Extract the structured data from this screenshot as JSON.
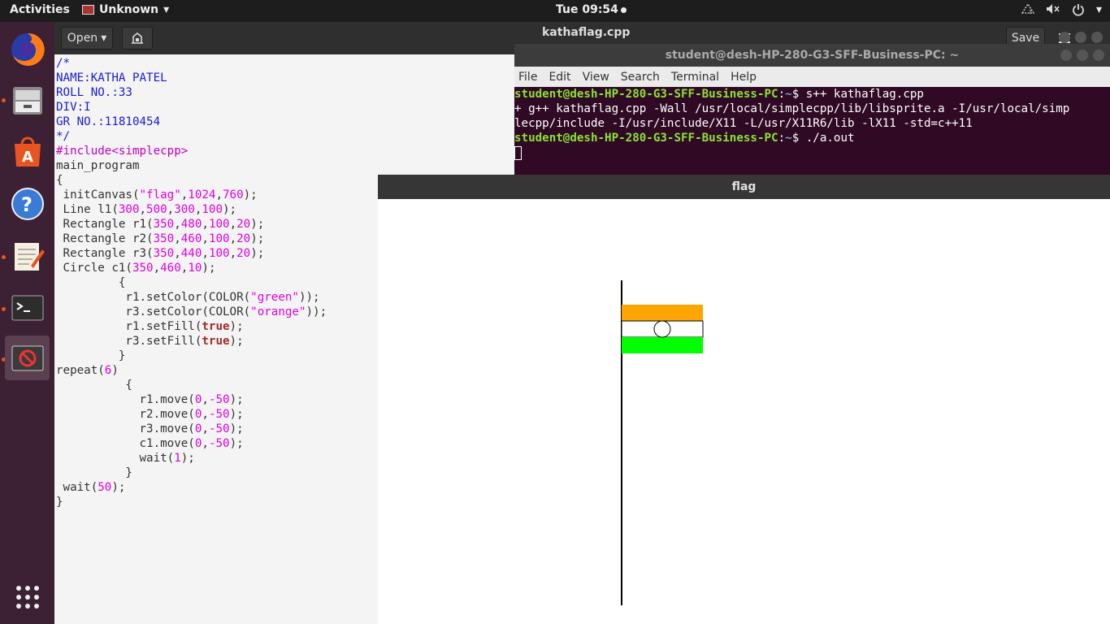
{
  "topbar": {
    "activities": "Activities",
    "app_name": "Unknown",
    "clock": "Tue 09:54"
  },
  "dock": {
    "items": [
      {
        "name": "firefox-icon"
      },
      {
        "name": "files-icon"
      },
      {
        "name": "software-center-icon"
      },
      {
        "name": "help-icon"
      },
      {
        "name": "text-editor-icon"
      },
      {
        "name": "terminal-icon"
      },
      {
        "name": "running-app-icon"
      },
      {
        "name": "show-apps-icon"
      }
    ]
  },
  "editor": {
    "open_label": "Open",
    "title": "kathaflag.cpp",
    "save_label": "Save",
    "code_lines": [
      "/*",
      "NAME:KATHA PATEL",
      "ROLL NO.:33",
      "DIV:I",
      "GR NO.:11810454",
      "*/",
      "#include<simplecpp>",
      "main_program",
      "{",
      " initCanvas(\"flag\",1024,760);",
      " Line l1(300,500,300,100);",
      " Rectangle r1(350,480,100,20);",
      " Rectangle r2(350,460,100,20);",
      " Rectangle r3(350,440,100,20);",
      " Circle c1(350,460,10);",
      "         {",
      "          r1.setColor(COLOR(\"green\"));",
      "          r3.setColor(COLOR(\"orange\"));",
      "          r1.setFill(true);",
      "          r3.setFill(true);",
      "         }",
      "repeat(6)",
      "          {",
      "            r1.move(0,-50);",
      "            r2.move(0,-50);",
      "            r3.move(0,-50);",
      "            c1.move(0,-50);",
      "            wait(1);",
      "          }",
      " wait(50);",
      "}"
    ]
  },
  "terminal": {
    "title": "student@desh-HP-280-G3-SFF-Business-PC: ~",
    "menu": [
      "File",
      "Edit",
      "View",
      "Search",
      "Terminal",
      "Help"
    ],
    "prompt_user": "student@desh-HP-280-G3-SFF-Business-PC",
    "prompt_path": "~",
    "cmd1": "$ s++ kathaflag.cpp",
    "out1": "+ g++ kathaflag.cpp -Wall /usr/local/simplecpp/lib/libsprite.a -I/usr/local/simp",
    "out2": "lecpp/include -I/usr/include/X11 -L/usr/X11R6/lib -lX11 -std=c++11",
    "cmd2": "$ ./a.out"
  },
  "flag_window": {
    "title": "flag",
    "colors": {
      "top": "#ffa500",
      "middle": "#ffffff",
      "bottom": "#00ff00",
      "pole": "#000000"
    }
  }
}
